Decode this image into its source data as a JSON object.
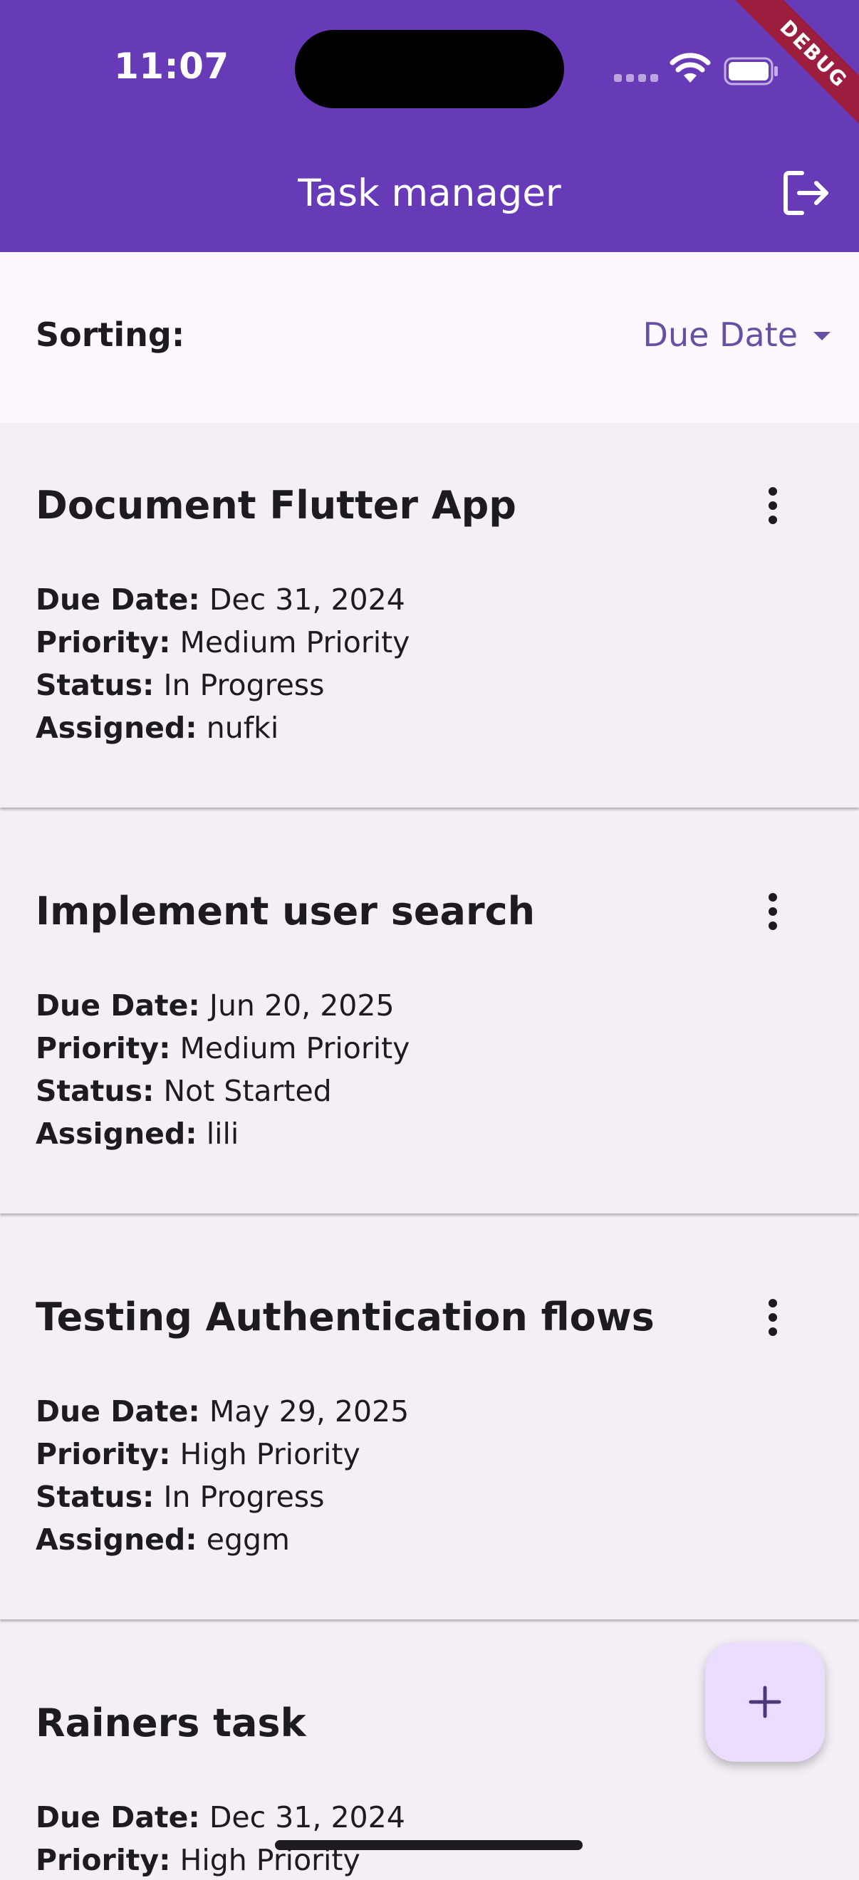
{
  "status_bar": {
    "time": "11:07",
    "debug_banner": "DEBUG",
    "icons": [
      "cellular-signal-icon",
      "wifi-icon",
      "battery-icon"
    ]
  },
  "app_bar": {
    "title": "Task manager",
    "action_icon": "logout-icon",
    "background_color": "#673ab7"
  },
  "sorting": {
    "label": "Sorting:",
    "selected": "Due Date",
    "accent_color": "#6750a4"
  },
  "field_labels": {
    "due_date": "Due Date:",
    "priority": "Priority:",
    "status": "Status:",
    "assigned": "Assigned:"
  },
  "tasks": [
    {
      "title": "Document Flutter App",
      "due_date": "Dec 31, 2024",
      "priority": "Medium Priority",
      "status": "In Progress",
      "assigned": "nufki"
    },
    {
      "title": "Implement user search",
      "due_date": "Jun 20, 2025",
      "priority": "Medium Priority",
      "status": "Not Started",
      "assigned": "lili"
    },
    {
      "title": "Testing Authentication flows",
      "due_date": "May 29, 2025",
      "priority": "High Priority",
      "status": "In Progress",
      "assigned": "eggm"
    },
    {
      "title": "Rainers task",
      "due_date": "Dec 31, 2024",
      "priority": "High Priority"
    }
  ],
  "fab": {
    "icon": "add-icon",
    "background_color": "#eaddff"
  }
}
